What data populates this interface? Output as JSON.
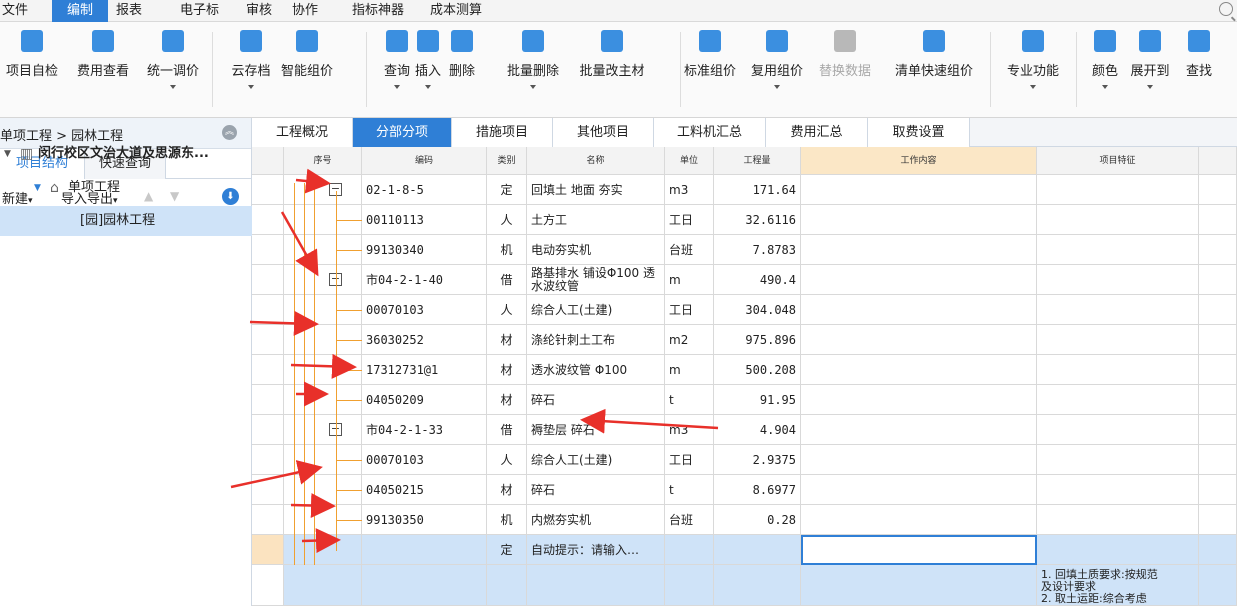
{
  "menu": {
    "items": [
      "文件",
      "编制",
      "报表",
      "电子标",
      "审核",
      "协作",
      "指标神器",
      "成本测算"
    ],
    "active_index": 1
  },
  "ribbon": {
    "buttons": [
      {
        "label": "项目自检",
        "icon": "checklist-icon",
        "color": "#3b8fe0"
      },
      {
        "label": "费用查看",
        "icon": "fee-view-icon",
        "color": "#3b8fe0"
      },
      {
        "label": "统一调价",
        "icon": "adjust-price-icon",
        "color": "#3b8fe0"
      },
      {
        "label": "云存档",
        "icon": "cloud-upload-icon",
        "color": "#3b8fe0"
      },
      {
        "label": "智能组价",
        "icon": "smart-price-icon",
        "color": "#3b8fe0"
      },
      {
        "label": "查询",
        "icon": "query-icon",
        "color": "#3b8fe0"
      },
      {
        "label": "插入",
        "icon": "insert-icon",
        "color": "#3b8fe0"
      },
      {
        "label": "删除",
        "icon": "delete-icon",
        "color": "#3b8fe0"
      },
      {
        "label": "批量删除",
        "icon": "batch-delete-icon",
        "color": "#3b8fe0"
      },
      {
        "label": "批量改主材",
        "icon": "batch-edit-icon",
        "color": "#3b8fe0"
      },
      {
        "label": "标准组价",
        "icon": "standard-price-icon",
        "color": "#3b8fe0"
      },
      {
        "label": "复用组价",
        "icon": "reuse-price-icon",
        "color": "#3b8fe0"
      },
      {
        "label": "替换数据",
        "icon": "replace-data-icon",
        "color": "#b8b8b8"
      },
      {
        "label": "清单快速组价",
        "icon": "quick-price-icon",
        "color": "#3b8fe0"
      },
      {
        "label": "专业功能",
        "icon": "professional-icon",
        "color": "#3b8fe0"
      },
      {
        "label": "颜色",
        "icon": "color-fill-icon",
        "color": "#3b8fe0"
      },
      {
        "label": "展开到",
        "icon": "expand-to-icon",
        "color": "#3b8fe0"
      },
      {
        "label": "查找",
        "icon": "find-icon",
        "color": "#3b8fe0"
      }
    ]
  },
  "left_panel": {
    "breadcrumb": "单项工程 > 园林工程",
    "tabs": [
      "项目结构",
      "快速查询"
    ],
    "toolbar": {
      "new_label": "新建",
      "import_export_label": "导入导出"
    },
    "tree": [
      {
        "label": "闵行校区文治大道及思源东...",
        "level": 0,
        "icon": "building-icon"
      },
      {
        "label": "单项工程",
        "level": 1,
        "icon": "home-icon"
      },
      {
        "label": "[园]园林工程",
        "level": 2,
        "selected": true
      }
    ]
  },
  "main_tabs": [
    "工程概况",
    "分部分项",
    "措施项目",
    "其他项目",
    "工料机汇总",
    "费用汇总",
    "取费设置"
  ],
  "main_tabs_active_index": 1,
  "grid": {
    "headers": [
      "序号",
      "编码",
      "类别",
      "名称",
      "单位",
      "工程量",
      "工作内容",
      "项目特征"
    ],
    "rows": [
      {
        "code": "02-1-8-5",
        "type": "定",
        "name": "回填土 地面 夯实",
        "unit": "m3",
        "qty": "171.64",
        "expander": true
      },
      {
        "code": "00110113",
        "type": "人",
        "name": "土方工",
        "unit": "工日",
        "qty": "32.6116"
      },
      {
        "code": "99130340",
        "type": "机",
        "name": "电动夯实机",
        "unit": "台班",
        "qty": "7.8783"
      },
      {
        "code": "市04-2-1-40",
        "type": "借",
        "name": "路基排水 铺设Φ100 透水波纹管",
        "unit": "m",
        "qty": "490.4",
        "expander": true
      },
      {
        "code": "00070103",
        "type": "人",
        "name": "综合人工(土建)",
        "unit": "工日",
        "qty": "304.048"
      },
      {
        "code": "36030252",
        "type": "材",
        "name": "涤纶针刺土工布",
        "unit": "m2",
        "qty": "975.896"
      },
      {
        "code": "17312731@1",
        "type": "材",
        "name": "透水波纹管 Φ100",
        "unit": "m",
        "qty": "500.208"
      },
      {
        "code": "04050209",
        "type": "材",
        "name": "碎石",
        "unit": "t",
        "qty": "91.95"
      },
      {
        "code": "市04-2-1-33",
        "type": "借",
        "name": "褥垫层 碎石",
        "unit": "m3",
        "qty": "4.904",
        "expander": true
      },
      {
        "code": "00070103",
        "type": "人",
        "name": "综合人工(土建)",
        "unit": "工日",
        "qty": "2.9375"
      },
      {
        "code": "04050215",
        "type": "材",
        "name": "碎石",
        "unit": "t",
        "qty": "8.6977"
      },
      {
        "code": "99130350",
        "type": "机",
        "name": "内燃夯实机",
        "unit": "台班",
        "qty": "0.28"
      },
      {
        "code": "",
        "type": "定",
        "name": "自动提示：请输入…",
        "unit": "",
        "qty": "",
        "editing": true
      }
    ],
    "feature_text": [
      "1. 回填土质要求:按规范",
      "及设计要求",
      "2. 取土运距:综合考虑"
    ]
  }
}
